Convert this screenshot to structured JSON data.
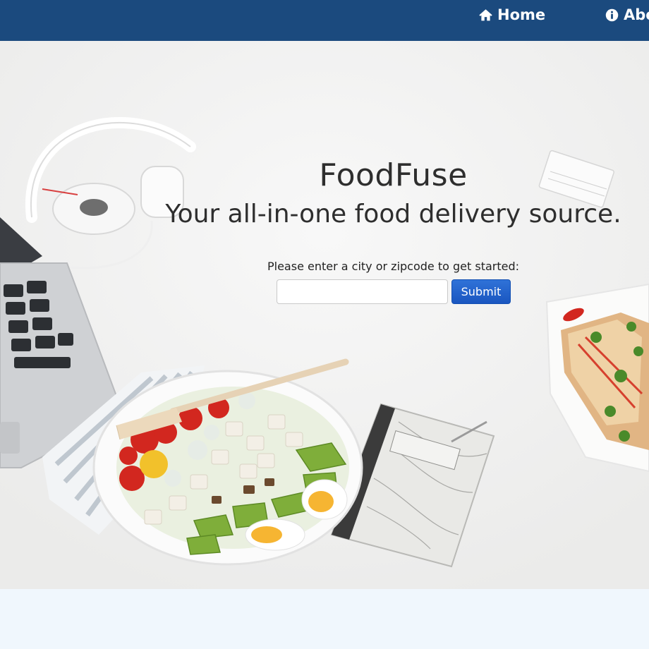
{
  "nav": {
    "items": [
      {
        "label": "Home",
        "icon": "home-icon"
      },
      {
        "label": "Abo",
        "icon": "info-icon"
      }
    ],
    "background": "#1b4a7e"
  },
  "hero": {
    "title": "FoodFuse",
    "tagline": "Your all-in-one food delivery source.",
    "prompt": "Please enter a city or zipcode to get started:",
    "search": {
      "value": "",
      "placeholder": ""
    },
    "submit_label": "Submit",
    "image_subjects": [
      "laptop-image",
      "headphones-image",
      "salad-bowl-image",
      "notebook-image",
      "sandwich-image",
      "calendar-image"
    ]
  },
  "colors": {
    "accent": "#1a56c0",
    "footer": "#f0f7fd"
  }
}
